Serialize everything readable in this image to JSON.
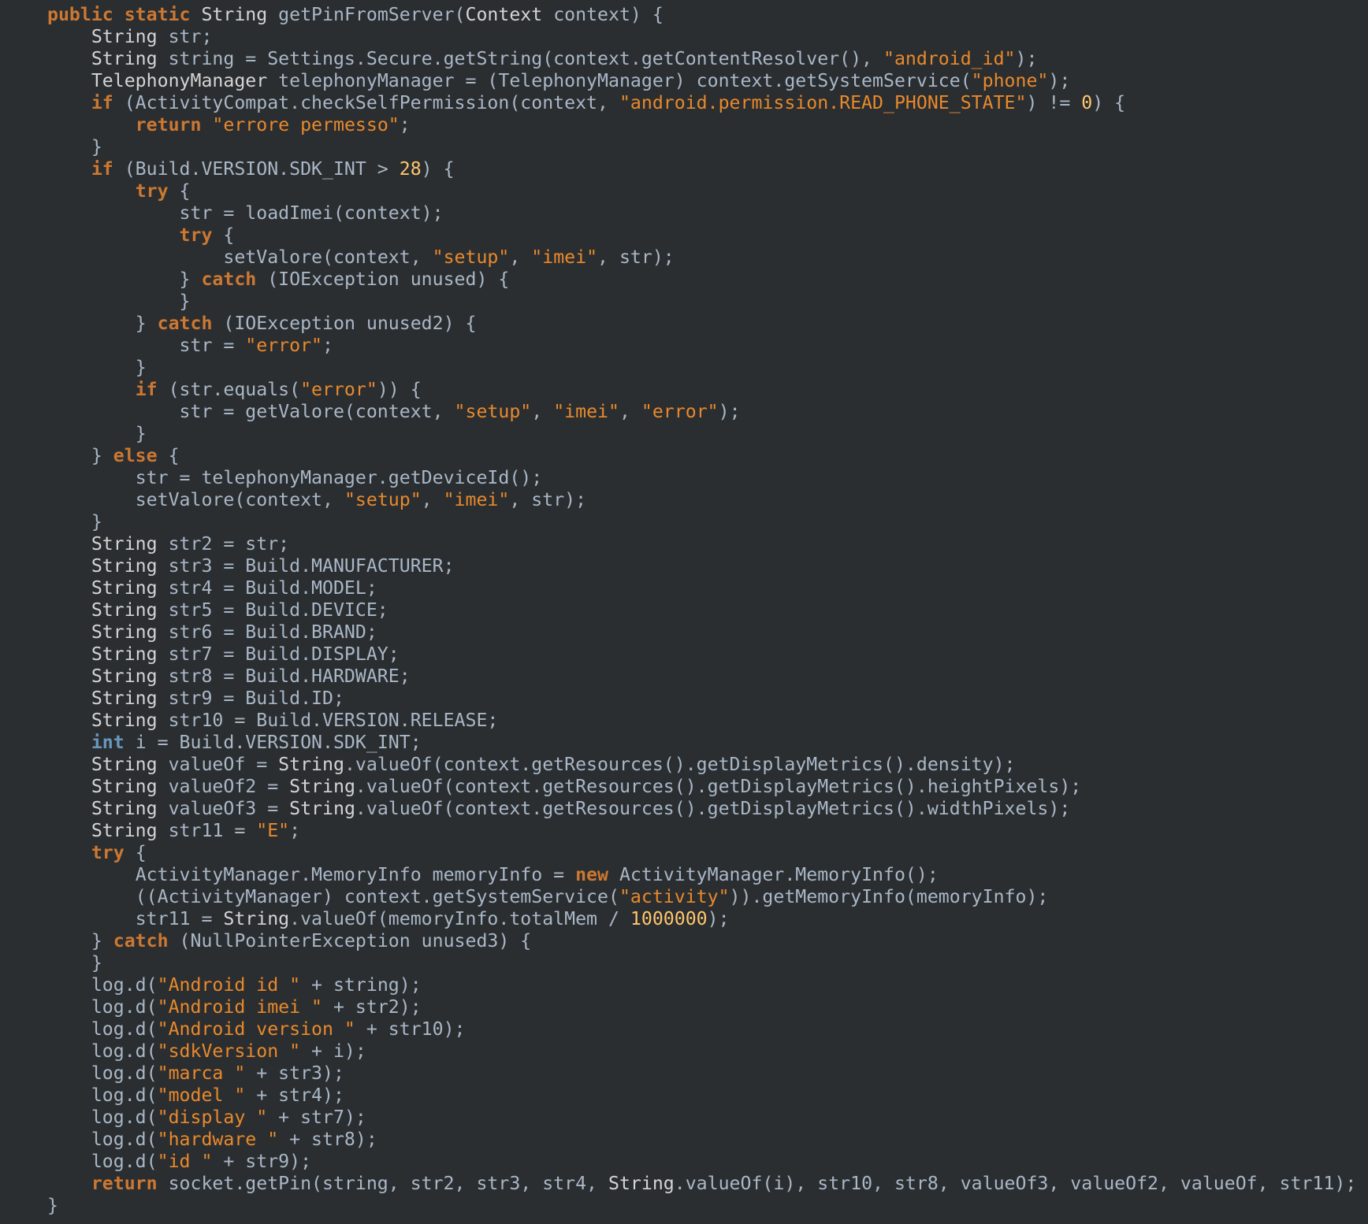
{
  "colors": {
    "background": "#2b2e31",
    "plain": "#a9b7c6",
    "type": "#d4d4d4",
    "keyword": "#cc7832",
    "string": "#e8892b",
    "number": "#ffc66d",
    "int_keyword": "#6897bb"
  },
  "code": {
    "lines": [
      {
        "indent": 0,
        "tokens": [
          [
            "kw",
            "public static"
          ],
          [
            "plain",
            " "
          ],
          [
            "type",
            "String"
          ],
          [
            "plain",
            " getPinFromServer("
          ],
          [
            "type",
            "Context"
          ],
          [
            "plain",
            " context) {"
          ]
        ]
      },
      {
        "indent": 1,
        "tokens": [
          [
            "type",
            "String"
          ],
          [
            "plain",
            " str;"
          ]
        ]
      },
      {
        "indent": 1,
        "tokens": [
          [
            "type",
            "String"
          ],
          [
            "plain",
            " string = Settings.Secure.getString(context.getContentResolver(), "
          ],
          [
            "str",
            "\"android_id\""
          ],
          [
            "plain",
            ");"
          ]
        ]
      },
      {
        "indent": 1,
        "tokens": [
          [
            "type",
            "TelephonyManager"
          ],
          [
            "plain",
            " telephonyManager = (TelephonyManager) context.getSystemService("
          ],
          [
            "str",
            "\"phone\""
          ],
          [
            "plain",
            ");"
          ]
        ]
      },
      {
        "indent": 1,
        "tokens": [
          [
            "kw",
            "if"
          ],
          [
            "plain",
            " (ActivityCompat.checkSelfPermission(context, "
          ],
          [
            "str",
            "\"android.permission.READ_PHONE_STATE\""
          ],
          [
            "plain",
            ") != "
          ],
          [
            "num",
            "0"
          ],
          [
            "plain",
            ") {"
          ]
        ]
      },
      {
        "indent": 2,
        "tokens": [
          [
            "kw",
            "return"
          ],
          [
            "plain",
            " "
          ],
          [
            "str",
            "\"errore permesso\""
          ],
          [
            "plain",
            ";"
          ]
        ]
      },
      {
        "indent": 1,
        "tokens": [
          [
            "plain",
            "}"
          ]
        ]
      },
      {
        "indent": 1,
        "tokens": [
          [
            "kw",
            "if"
          ],
          [
            "plain",
            " (Build.VERSION.SDK_INT > "
          ],
          [
            "num",
            "28"
          ],
          [
            "plain",
            ") {"
          ]
        ]
      },
      {
        "indent": 2,
        "tokens": [
          [
            "kw",
            "try"
          ],
          [
            "plain",
            " {"
          ]
        ]
      },
      {
        "indent": 3,
        "tokens": [
          [
            "plain",
            "str = loadImei(context);"
          ]
        ]
      },
      {
        "indent": 3,
        "tokens": [
          [
            "kw",
            "try"
          ],
          [
            "plain",
            " {"
          ]
        ]
      },
      {
        "indent": 4,
        "tokens": [
          [
            "plain",
            "setValore(context, "
          ],
          [
            "str",
            "\"setup\""
          ],
          [
            "plain",
            ", "
          ],
          [
            "str",
            "\"imei\""
          ],
          [
            "plain",
            ", str);"
          ]
        ]
      },
      {
        "indent": 3,
        "tokens": [
          [
            "plain",
            "} "
          ],
          [
            "kw",
            "catch"
          ],
          [
            "plain",
            " (IOException unused) {"
          ]
        ]
      },
      {
        "indent": 3,
        "tokens": [
          [
            "plain",
            "}"
          ]
        ]
      },
      {
        "indent": 2,
        "tokens": [
          [
            "plain",
            "} "
          ],
          [
            "kw",
            "catch"
          ],
          [
            "plain",
            " (IOException unused2) {"
          ]
        ]
      },
      {
        "indent": 3,
        "tokens": [
          [
            "plain",
            "str = "
          ],
          [
            "str",
            "\"error\""
          ],
          [
            "plain",
            ";"
          ]
        ]
      },
      {
        "indent": 2,
        "tokens": [
          [
            "plain",
            "}"
          ]
        ]
      },
      {
        "indent": 2,
        "tokens": [
          [
            "kw",
            "if"
          ],
          [
            "plain",
            " (str.equals("
          ],
          [
            "str",
            "\"error\""
          ],
          [
            "plain",
            ")) {"
          ]
        ]
      },
      {
        "indent": 3,
        "tokens": [
          [
            "plain",
            "str = getValore(context, "
          ],
          [
            "str",
            "\"setup\""
          ],
          [
            "plain",
            ", "
          ],
          [
            "str",
            "\"imei\""
          ],
          [
            "plain",
            ", "
          ],
          [
            "str",
            "\"error\""
          ],
          [
            "plain",
            ");"
          ]
        ]
      },
      {
        "indent": 2,
        "tokens": [
          [
            "plain",
            "}"
          ]
        ]
      },
      {
        "indent": 1,
        "tokens": [
          [
            "plain",
            "} "
          ],
          [
            "kw",
            "else"
          ],
          [
            "plain",
            " {"
          ]
        ]
      },
      {
        "indent": 2,
        "tokens": [
          [
            "plain",
            "str = telephonyManager.getDeviceId();"
          ]
        ]
      },
      {
        "indent": 2,
        "tokens": [
          [
            "plain",
            "setValore(context, "
          ],
          [
            "str",
            "\"setup\""
          ],
          [
            "plain",
            ", "
          ],
          [
            "str",
            "\"imei\""
          ],
          [
            "plain",
            ", str);"
          ]
        ]
      },
      {
        "indent": 1,
        "tokens": [
          [
            "plain",
            "}"
          ]
        ]
      },
      {
        "indent": 1,
        "tokens": [
          [
            "type",
            "String"
          ],
          [
            "plain",
            " str2 = str;"
          ]
        ]
      },
      {
        "indent": 1,
        "tokens": [
          [
            "type",
            "String"
          ],
          [
            "plain",
            " str3 = Build.MANUFACTURER;"
          ]
        ]
      },
      {
        "indent": 1,
        "tokens": [
          [
            "type",
            "String"
          ],
          [
            "plain",
            " str4 = Build.MODEL;"
          ]
        ]
      },
      {
        "indent": 1,
        "tokens": [
          [
            "type",
            "String"
          ],
          [
            "plain",
            " str5 = Build.DEVICE;"
          ]
        ]
      },
      {
        "indent": 1,
        "tokens": [
          [
            "type",
            "String"
          ],
          [
            "plain",
            " str6 = Build.BRAND;"
          ]
        ]
      },
      {
        "indent": 1,
        "tokens": [
          [
            "type",
            "String"
          ],
          [
            "plain",
            " str7 = Build.DISPLAY;"
          ]
        ]
      },
      {
        "indent": 1,
        "tokens": [
          [
            "type",
            "String"
          ],
          [
            "plain",
            " str8 = Build.HARDWARE;"
          ]
        ]
      },
      {
        "indent": 1,
        "tokens": [
          [
            "type",
            "String"
          ],
          [
            "plain",
            " str9 = Build.ID;"
          ]
        ]
      },
      {
        "indent": 1,
        "tokens": [
          [
            "type",
            "String"
          ],
          [
            "plain",
            " str10 = Build.VERSION.RELEASE;"
          ]
        ]
      },
      {
        "indent": 1,
        "tokens": [
          [
            "int",
            "int"
          ],
          [
            "plain",
            " i = Build.VERSION.SDK_INT;"
          ]
        ]
      },
      {
        "indent": 1,
        "tokens": [
          [
            "type",
            "String"
          ],
          [
            "plain",
            " valueOf = "
          ],
          [
            "type",
            "String"
          ],
          [
            "plain",
            ".valueOf(context.getResources().getDisplayMetrics().density);"
          ]
        ]
      },
      {
        "indent": 1,
        "tokens": [
          [
            "type",
            "String"
          ],
          [
            "plain",
            " valueOf2 = "
          ],
          [
            "type",
            "String"
          ],
          [
            "plain",
            ".valueOf(context.getResources().getDisplayMetrics().heightPixels);"
          ]
        ]
      },
      {
        "indent": 1,
        "tokens": [
          [
            "type",
            "String"
          ],
          [
            "plain",
            " valueOf3 = "
          ],
          [
            "type",
            "String"
          ],
          [
            "plain",
            ".valueOf(context.getResources().getDisplayMetrics().widthPixels);"
          ]
        ]
      },
      {
        "indent": 1,
        "tokens": [
          [
            "type",
            "String"
          ],
          [
            "plain",
            " str11 = "
          ],
          [
            "str",
            "\"E\""
          ],
          [
            "plain",
            ";"
          ]
        ]
      },
      {
        "indent": 1,
        "tokens": [
          [
            "kw",
            "try"
          ],
          [
            "plain",
            " {"
          ]
        ]
      },
      {
        "indent": 2,
        "tokens": [
          [
            "plain",
            "ActivityManager.MemoryInfo memoryInfo = "
          ],
          [
            "kw",
            "new"
          ],
          [
            "plain",
            " ActivityManager.MemoryInfo();"
          ]
        ]
      },
      {
        "indent": 2,
        "tokens": [
          [
            "plain",
            "((ActivityManager) context.getSystemService("
          ],
          [
            "str",
            "\"activity\""
          ],
          [
            "plain",
            ")).getMemoryInfo(memoryInfo);"
          ]
        ]
      },
      {
        "indent": 2,
        "tokens": [
          [
            "plain",
            "str11 = "
          ],
          [
            "type",
            "String"
          ],
          [
            "plain",
            ".valueOf(memoryInfo.totalMem / "
          ],
          [
            "num",
            "1000000"
          ],
          [
            "plain",
            ");"
          ]
        ]
      },
      {
        "indent": 1,
        "tokens": [
          [
            "plain",
            "} "
          ],
          [
            "kw",
            "catch"
          ],
          [
            "plain",
            " (NullPointerException unused3) {"
          ]
        ]
      },
      {
        "indent": 1,
        "tokens": [
          [
            "plain",
            "}"
          ]
        ]
      },
      {
        "indent": 1,
        "tokens": [
          [
            "plain",
            "log.d("
          ],
          [
            "str",
            "\"Android id \""
          ],
          [
            "plain",
            " + string);"
          ]
        ]
      },
      {
        "indent": 1,
        "tokens": [
          [
            "plain",
            "log.d("
          ],
          [
            "str",
            "\"Android imei \""
          ],
          [
            "plain",
            " + str2);"
          ]
        ]
      },
      {
        "indent": 1,
        "tokens": [
          [
            "plain",
            "log.d("
          ],
          [
            "str",
            "\"Android version \""
          ],
          [
            "plain",
            " + str10);"
          ]
        ]
      },
      {
        "indent": 1,
        "tokens": [
          [
            "plain",
            "log.d("
          ],
          [
            "str",
            "\"sdkVersion \""
          ],
          [
            "plain",
            " + i);"
          ]
        ]
      },
      {
        "indent": 1,
        "tokens": [
          [
            "plain",
            "log.d("
          ],
          [
            "str",
            "\"marca \""
          ],
          [
            "plain",
            " + str3);"
          ]
        ]
      },
      {
        "indent": 1,
        "tokens": [
          [
            "plain",
            "log.d("
          ],
          [
            "str",
            "\"model \""
          ],
          [
            "plain",
            " + str4);"
          ]
        ]
      },
      {
        "indent": 1,
        "tokens": [
          [
            "plain",
            "log.d("
          ],
          [
            "str",
            "\"display \""
          ],
          [
            "plain",
            " + str7);"
          ]
        ]
      },
      {
        "indent": 1,
        "tokens": [
          [
            "plain",
            "log.d("
          ],
          [
            "str",
            "\"hardware \""
          ],
          [
            "plain",
            " + str8);"
          ]
        ]
      },
      {
        "indent": 1,
        "tokens": [
          [
            "plain",
            "log.d("
          ],
          [
            "str",
            "\"id \""
          ],
          [
            "plain",
            " + str9);"
          ]
        ]
      },
      {
        "indent": 1,
        "tokens": [
          [
            "kw",
            "return"
          ],
          [
            "plain",
            " socket.getPin(string, str2, str3, str4, "
          ],
          [
            "type",
            "String"
          ],
          [
            "plain",
            ".valueOf(i), str10, str8, valueOf3, valueOf2, valueOf, str11);"
          ]
        ]
      },
      {
        "indent": 0,
        "tokens": [
          [
            "plain",
            "}"
          ]
        ]
      }
    ]
  }
}
